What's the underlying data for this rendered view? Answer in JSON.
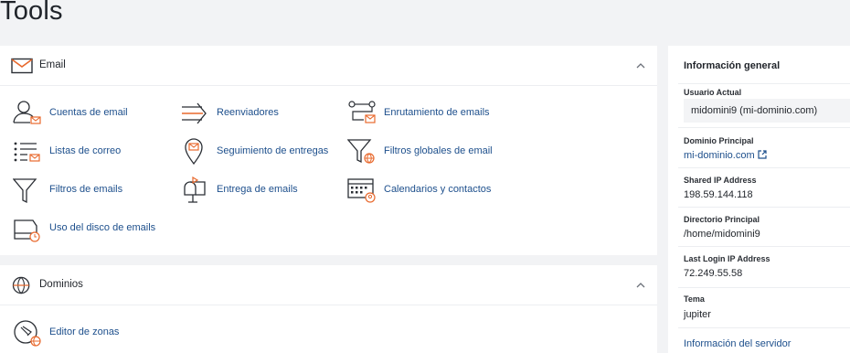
{
  "page": {
    "title": "Tools"
  },
  "email_panel": {
    "title": "Email",
    "tools": [
      {
        "label": "Cuentas de email",
        "icon": "user-mail-icon"
      },
      {
        "label": "Reenviadores",
        "icon": "forward-arrow-icon"
      },
      {
        "label": "Enrutamiento de emails",
        "icon": "email-routing-icon"
      },
      {
        "label": "Listas de correo",
        "icon": "mailing-list-icon"
      },
      {
        "label": "Seguimiento de entregas",
        "icon": "delivery-tracking-icon"
      },
      {
        "label": "Filtros globales de email",
        "icon": "global-filter-icon"
      },
      {
        "label": "Filtros de emails",
        "icon": "filter-icon"
      },
      {
        "label": "Entrega de emails",
        "icon": "mailbox-icon"
      },
      {
        "label": "Calendarios y contactos",
        "icon": "calendar-icon"
      },
      {
        "label": "Uso del disco de emails",
        "icon": "disk-usage-icon"
      }
    ]
  },
  "dominios_panel": {
    "title": "Dominios",
    "tools": [
      {
        "label": "Editor de zonas",
        "icon": "zone-editor-icon"
      }
    ]
  },
  "sidebar": {
    "title": "Información general",
    "current_user_label": "Usuario Actual",
    "current_user_value": "midomini9 (mi-dominio.com)",
    "primary_domain_label": "Dominio Principal",
    "primary_domain_value": "mi-dominio.com",
    "shared_ip_label": "Shared IP Address",
    "shared_ip_value": "198.59.144.118",
    "home_dir_label": "Directorio Principal",
    "home_dir_value": "/home/midomini9",
    "last_login_label": "Last Login IP Address",
    "last_login_value": "72.249.55.58",
    "theme_label": "Tema",
    "theme_value": "jupiter",
    "server_info_link": "Información del servidor"
  },
  "colors": {
    "accent": "#e8692d",
    "link": "#1d4f8c",
    "icon_stroke": "#2b2f35"
  }
}
